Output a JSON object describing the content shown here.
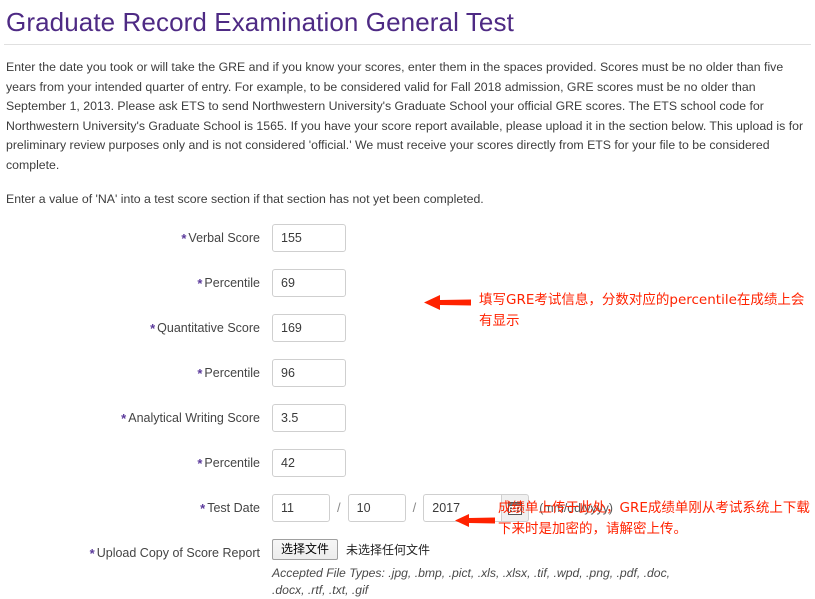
{
  "page": {
    "title": "Graduate Record Examination General Test",
    "intro_paragraph_1": "Enter the date you took or will take the GRE and if you know your scores, enter them in the spaces provided. Scores must be no older than five years from your intended quarter of entry. For example, to be considered valid for Fall 2018 admission, GRE scores must be no older than September 1, 2013. Please ask ETS to send Northwestern University's Graduate School your official GRE scores. The ETS school code for Northwestern University's Graduate School is 1565. If you have your score report available, please upload it in the section below. This upload is for preliminary review purposes only and is not considered 'official.' We must receive your scores directly from ETS for your file to be considered complete.",
    "intro_paragraph_2": "Enter a value of 'NA' into a test score section if that section has not yet been completed.",
    "title_color": "#4E2A84",
    "required_marker": "*"
  },
  "fields": {
    "verbal_score": {
      "label": "Verbal Score",
      "value": "155"
    },
    "verbal_percentile": {
      "label": "Percentile",
      "value": "69"
    },
    "quantitative_score": {
      "label": "Quantitative Score",
      "value": "169"
    },
    "quantitative_percentile": {
      "label": "Percentile",
      "value": "96"
    },
    "analytical_writing_score": {
      "label": "Analytical Writing Score",
      "value": "3.5"
    },
    "analytical_writing_percentile": {
      "label": "Percentile",
      "value": "42"
    },
    "test_date": {
      "label": "Test Date",
      "month": "11",
      "day": "10",
      "year": "2017",
      "separator": "/",
      "format_hint": "(mm/dd/yyyy)",
      "calendar_icon": "calendar-icon"
    },
    "upload": {
      "label": "Upload Copy of Score Report",
      "button_text": "选择文件",
      "status_text": "未选择任何文件",
      "accepted_types": "Accepted File Types: .jpg, .bmp, .pict, .xls, .xlsx, .tif, .wpd, .png, .pdf, .doc, .docx, .rtf, .txt, .gif"
    }
  },
  "annotations": {
    "color": "#ff2200",
    "note_1": "填写GRE考试信息，分数对应的percentile在成绩上会有显示",
    "note_2": "成绩单上传于此处，GRE成绩单刚从考试系统上下载下来时是加密的，请解密上传。"
  }
}
